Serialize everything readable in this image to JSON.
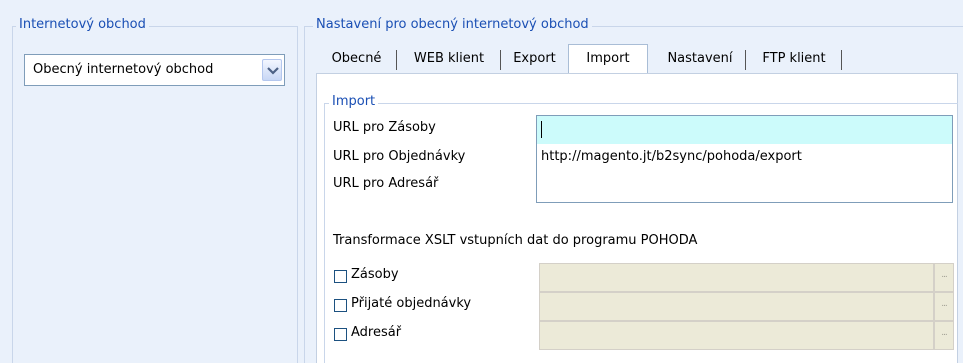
{
  "left_group": {
    "title": "Internetový obchod",
    "select_value": "Obecný internetový obchod",
    "arrow_icon": "chevron-down-icon"
  },
  "right_group": {
    "title": "Nastavení pro obecný internetový obchod",
    "tabs": [
      {
        "label": "Obecné",
        "active": false
      },
      {
        "label": "WEB klient",
        "active": false
      },
      {
        "label": "Export",
        "active": false
      },
      {
        "label": "Import",
        "active": true
      },
      {
        "label": "Nastavení",
        "active": false
      },
      {
        "label": "FTP klient",
        "active": false
      }
    ]
  },
  "import_group": {
    "title": "Import",
    "urls": [
      {
        "label": "URL pro Zásoby",
        "value": ""
      },
      {
        "label": "URL pro Objednávky",
        "value": "http://magento.jt/b2sync/pohoda/export"
      },
      {
        "label": "URL pro Adresář",
        "value": ""
      }
    ],
    "xslt_heading": "Transformace XSLT vstupních dat do programu POHODA",
    "xslt_items": [
      {
        "label": "Zásoby",
        "checked": false,
        "path": "",
        "browse_label": "..."
      },
      {
        "label": "Přijaté objednávky",
        "checked": false,
        "path": "",
        "browse_label": "..."
      },
      {
        "label": "Adresář",
        "checked": false,
        "path": "",
        "browse_label": "..."
      }
    ]
  },
  "colors": {
    "background": "#eaf1fb",
    "group_title": "#1a4fb4",
    "active_input": "#ccfbfb",
    "disabled_field": "#ecead8"
  }
}
